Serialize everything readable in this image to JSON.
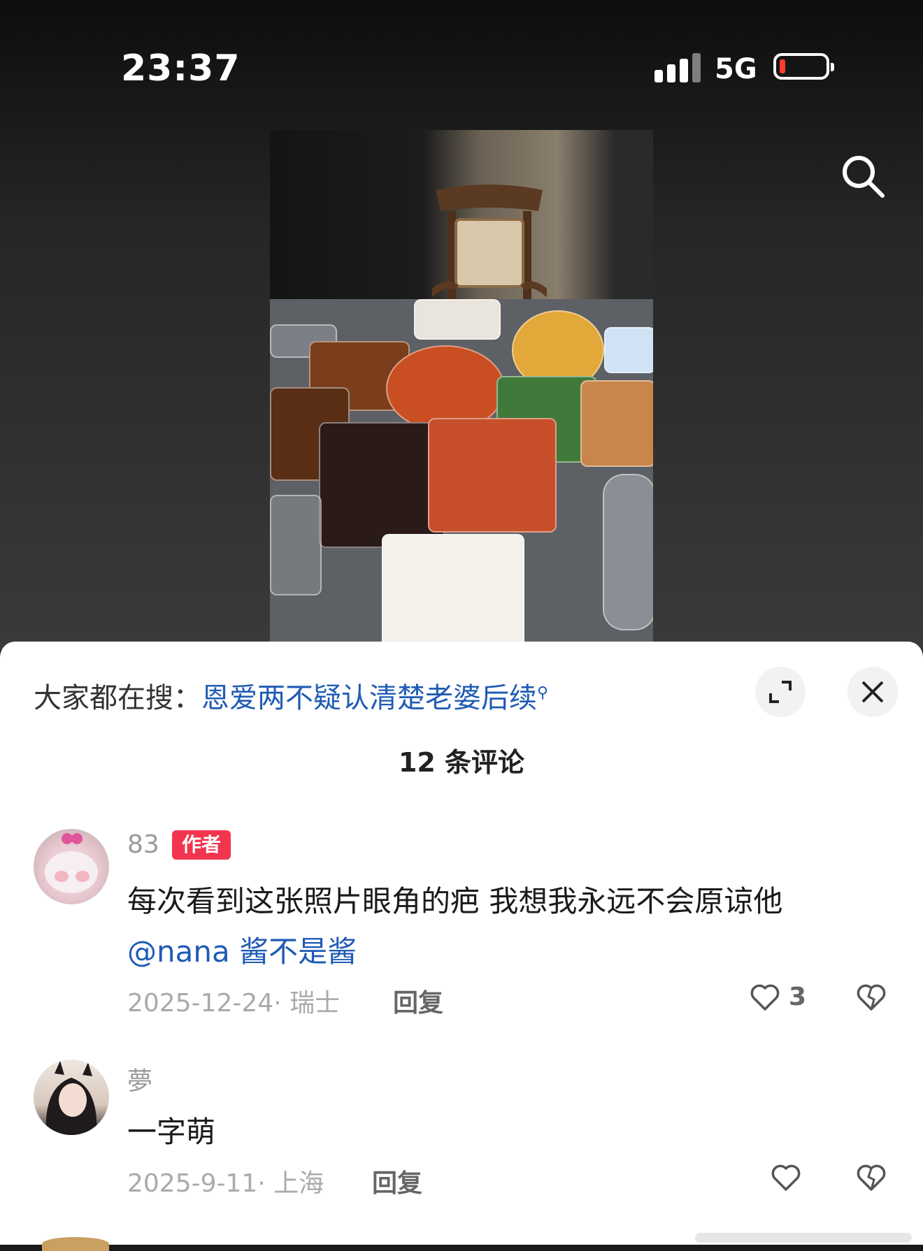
{
  "status_bar": {
    "time": "23:37",
    "network": "5G",
    "battery_level": 0.1
  },
  "hot_search": {
    "prefix": "大家都在搜：",
    "query": "恩爱两不疑认清楚老婆后续"
  },
  "comments_title": "12 条评论",
  "comments": [
    {
      "username": "83",
      "badge": "作者",
      "text": "每次看到这张照片眼角的疤 我想我永远不会原谅他",
      "mention": "@nana 酱不是酱",
      "date": "2025-12-24",
      "location": "· 瑞士",
      "reply_label": "回复",
      "likes": "3"
    },
    {
      "username": "夢",
      "text": "一字萌",
      "date": "2025-9-11",
      "location": "· 上海",
      "reply_label": "回复",
      "likes": ""
    }
  ],
  "icons": {
    "search": "search-icon",
    "expand": "expand-icon",
    "close": "close-icon",
    "like": "heart-icon",
    "dislike": "broken-heart-icon"
  }
}
